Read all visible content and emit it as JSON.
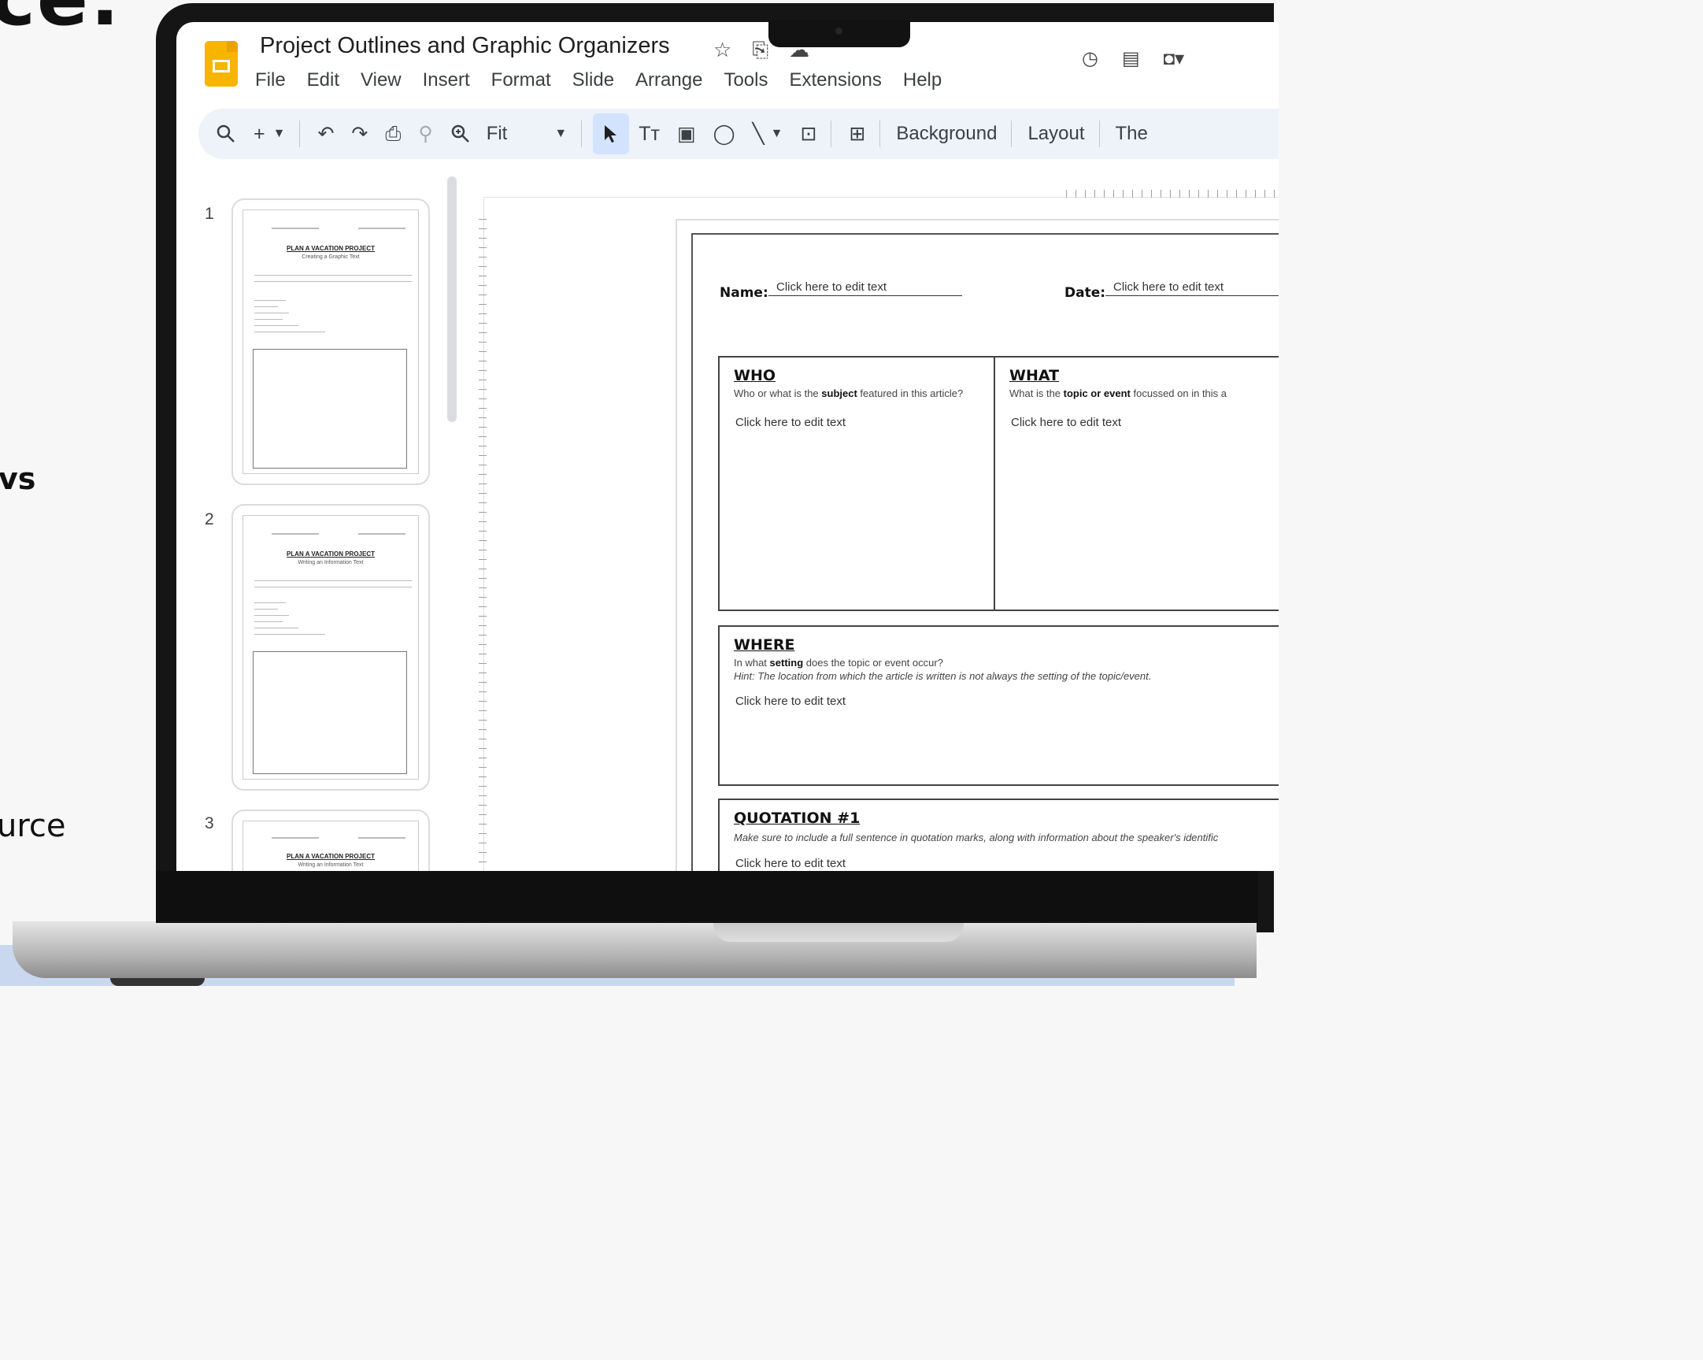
{
  "background": {
    "top_text": "ce:",
    "middle_text": "vs",
    "bottom_text": "urce"
  },
  "app": {
    "title": "Project Outlines and Graphic Organizers",
    "menu": [
      "File",
      "Edit",
      "View",
      "Insert",
      "Format",
      "Slide",
      "Arrange",
      "Tools",
      "Extensions",
      "Help"
    ],
    "title_icons": [
      "star-icon",
      "move-to-folder-icon",
      "cloud-saved-icon"
    ],
    "right_icons": [
      "history-icon",
      "comments-icon",
      "meet-icon"
    ]
  },
  "toolbar": {
    "zoom_label": "Fit",
    "background_label": "Background",
    "layout_label": "Layout",
    "theme_label": "The"
  },
  "filmstrip": {
    "slides": [
      {
        "number": "1",
        "title": "PLAN A VACATION PROJECT",
        "subtitle": "Creating a Graphic Text"
      },
      {
        "number": "2",
        "title": "PLAN A VACATION PROJECT",
        "subtitle": "Writing an Information Text"
      },
      {
        "number": "3",
        "title": "PLAN A VACATION PROJECT",
        "subtitle": "Writing an Information Text"
      }
    ]
  },
  "slide": {
    "name_label": "Name:",
    "name_value": "Click here to edit text",
    "date_label": "Date:",
    "date_value": "Click here to edit text",
    "who": {
      "heading": "WHO",
      "desc_pre": "Who or what is the ",
      "desc_bold": "subject",
      "desc_post": " featured in this article?",
      "edit": "Click here to edit text"
    },
    "what": {
      "heading": "WHAT",
      "desc_pre": "What is the ",
      "desc_bold": "topic or event",
      "desc_post": " focussed on in this a",
      "edit": "Click here to edit text"
    },
    "where": {
      "heading": "WHERE",
      "desc_pre": "In what ",
      "desc_bold": "setting",
      "desc_post": " does the topic or event occur?",
      "hint": "Hint: The location from which the article is written is not always the setting of the topic/event.",
      "edit": "Click here to edit text"
    },
    "quotation": {
      "heading": "QUOTATION #1",
      "hint": "Make sure to include a full sentence in quotation marks, along with information about the speaker's identific",
      "edit": "Click here to edit text"
    }
  }
}
